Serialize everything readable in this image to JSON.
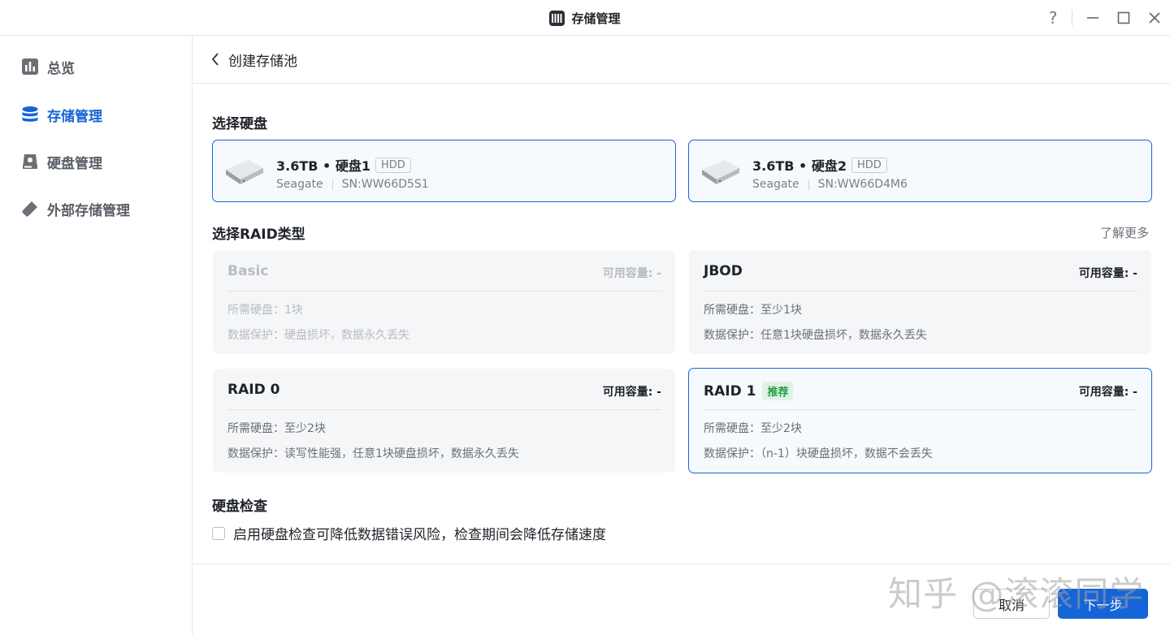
{
  "window": {
    "title": "存储管理",
    "app_icon": "storage-app-icon",
    "controls": [
      "help-icon",
      "minimize-icon",
      "maximize-icon",
      "close-icon"
    ],
    "help_label": "?"
  },
  "sidebar": {
    "items": [
      {
        "label": "总览",
        "icon": "chart-icon",
        "active": false
      },
      {
        "label": "存储管理",
        "icon": "database-icon",
        "active": true
      },
      {
        "label": "硬盘管理",
        "icon": "hard-disk-icon",
        "active": false
      },
      {
        "label": "外部存储管理",
        "icon": "usb-drive-icon",
        "active": false
      }
    ]
  },
  "header": {
    "back_icon": "chevron-left-icon",
    "title": "创建存储池"
  },
  "disks": {
    "title": "选择硬盘",
    "items": [
      {
        "name": "3.6TB • 硬盘1",
        "type": "HDD",
        "brand": "Seagate",
        "sn": "SN:WW66D5S1",
        "selected": true
      },
      {
        "name": "3.6TB • 硬盘2",
        "type": "HDD",
        "brand": "Seagate",
        "sn": "SN:WW66D4M6",
        "selected": true
      }
    ]
  },
  "raid": {
    "title": "选择RAID类型",
    "learn_more": "了解更多",
    "options": [
      {
        "name": "Basic",
        "capacity": "可用容量: -",
        "required": "所需硬盘：1块",
        "protection": "数据保护：硬盘损坏，数据永久丢失",
        "disabled": true,
        "selected": false,
        "tag": ""
      },
      {
        "name": "JBOD",
        "capacity": "可用容量: -",
        "required": "所需硬盘：至少1块",
        "protection": "数据保护：任意1块硬盘损坏，数据永久丢失",
        "disabled": false,
        "selected": false,
        "tag": ""
      },
      {
        "name": "RAID 0",
        "capacity": "可用容量: -",
        "required": "所需硬盘：至少2块",
        "protection": "数据保护：读写性能强，任意1块硬盘损坏，数据永久丢失",
        "disabled": false,
        "selected": false,
        "tag": ""
      },
      {
        "name": "RAID 1",
        "capacity": "可用容量: -",
        "required": "所需硬盘：至少2块",
        "protection": "数据保护：（n-1）块硬盘损坏，数据不会丢失",
        "disabled": false,
        "selected": true,
        "tag": "推荐"
      }
    ]
  },
  "disk_check": {
    "title": "硬盘检查",
    "label": "启用硬盘检查可降低数据错误风险，检查期间会降低存储速度",
    "checked": false
  },
  "footer": {
    "cancel_label": "取消",
    "next_label": "下一步"
  },
  "watermark": "知乎 @滚滚同学",
  "colors": {
    "accent": "#1665d8",
    "recommend_text": "#1f9d41",
    "recommend_bg": "#dff3e4"
  }
}
